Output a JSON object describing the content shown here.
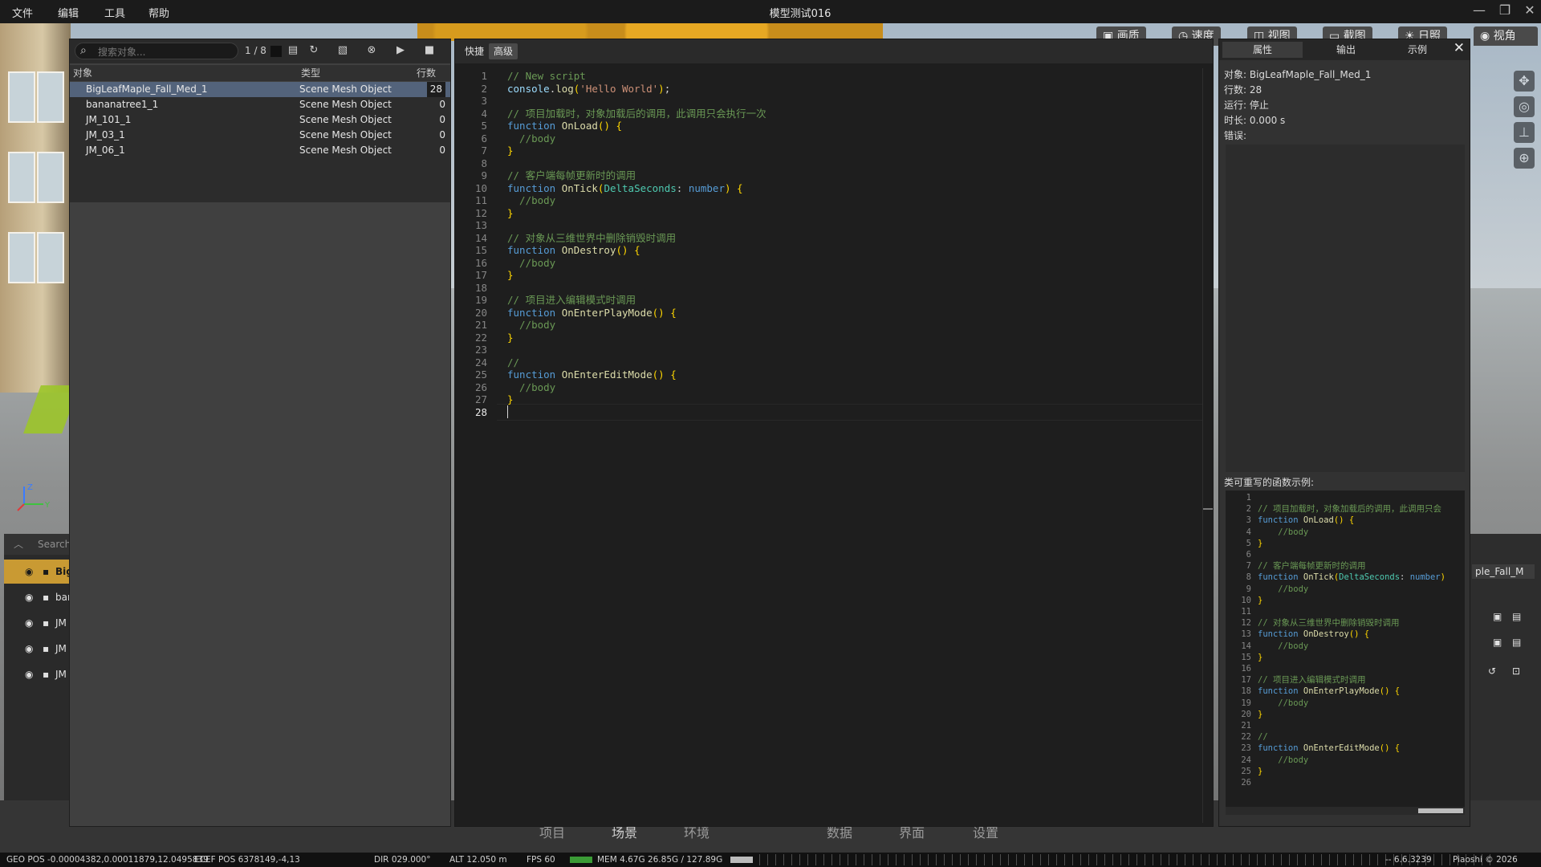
{
  "titlebar": {
    "menus": [
      "文件",
      "编辑",
      "工具",
      "帮助"
    ],
    "title": "模型测试016",
    "controls": [
      "minimize-icon",
      "restore-icon",
      "close-icon"
    ]
  },
  "viewport_tabs": [
    "画质",
    "速度",
    "视图",
    "截图",
    "日照",
    "视角"
  ],
  "object_panel": {
    "search_placeholder": "搜索对象...",
    "page_indicator": "1 / 8",
    "columns": [
      "对象",
      "类型",
      "行数"
    ],
    "rows": [
      {
        "name": "BigLeafMaple_Fall_Med_1",
        "type": "Scene Mesh Object",
        "lines": "28"
      },
      {
        "name": "bananatree1_1",
        "type": "Scene Mesh Object",
        "lines": "0"
      },
      {
        "name": "JM_101_1",
        "type": "Scene Mesh Object",
        "lines": "0"
      },
      {
        "name": "JM_03_1",
        "type": "Scene Mesh Object",
        "lines": "0"
      },
      {
        "name": "JM_06_1",
        "type": "Scene Mesh Object",
        "lines": "0"
      }
    ]
  },
  "editor": {
    "tabs": [
      "快捷",
      "高级"
    ],
    "lines": [
      "// New script",
      "console.log('Hello World');",
      "",
      "// 项目加载时，对象加载后的调用，此调用只会执行一次",
      "function OnLoad() {",
      "  //body",
      "}",
      "",
      "// 客户端每帧更新时的调用",
      "function OnTick(DeltaSeconds: number) {",
      "  //body",
      "}",
      "",
      "// 对象从三维世界中删除销毁时调用",
      "function OnDestroy() {",
      "  //body",
      "}",
      "",
      "// 项目进入编辑模式时调用",
      "function OnEnterPlayMode() {",
      "  //body",
      "}",
      "",
      "//",
      "function OnEnterEditMode() {",
      "  //body",
      "}",
      ""
    ]
  },
  "properties": {
    "tabs": [
      "属性",
      "输出",
      "示例"
    ],
    "object_label": "对象: BigLeafMaple_Fall_Med_1",
    "lines_label": "行数: 28",
    "run_label": "运行: 停止",
    "duration_label": "时长: 0.000 s",
    "error_label": "错误:",
    "sample_title": "类可重写的函数示例:",
    "sample_lines": [
      "",
      "// 项目加载时，对象加载后的调用，此调用只会",
      "function OnLoad() {",
      "    //body",
      "}",
      "",
      "// 客户端每帧更新时的调用",
      "function OnTick(DeltaSeconds: number)",
      "    //body",
      "}",
      "",
      "// 对象从三维世界中删除销毁时调用",
      "function OnDestroy() {",
      "    //body",
      "}",
      "",
      "// 项目进入编辑模式时调用",
      "function OnEnterPlayMode() {",
      "    //body",
      "}",
      "",
      "//",
      "function OnEnterEditMode() {",
      "    //body",
      "}",
      ""
    ]
  },
  "scene_tree": {
    "search_placeholder": "Search",
    "rows": [
      "Big",
      "bar",
      "JM",
      "JM",
      "JM"
    ]
  },
  "right_panel": {
    "name_fragment": "ple_Fall_M"
  },
  "bottom_nav": [
    "项目",
    "场景",
    "环境",
    "数据",
    "界面",
    "设置"
  ],
  "statusbar": {
    "geo_pos": "GEO POS  -0.00004382,0.00011879,12.0495839",
    "ecef_pos": "ECEF POS  6378149,-4,13",
    "dir": "DIR   029.000°",
    "alt": "ALT   12.050 m",
    "fps": "FPS   60",
    "mem": "MEM   4.67G   26.85G / 127.89G",
    "version": "-- 6.6.3239",
    "copyright": "Piaoshi © 2026"
  },
  "colors": {
    "accent_selected_row": "#53637b",
    "scene_selected": "#c99a33",
    "comment": "#6a9955",
    "keyword": "#569cd6",
    "function": "#dcdcaa",
    "string": "#ce9178"
  }
}
